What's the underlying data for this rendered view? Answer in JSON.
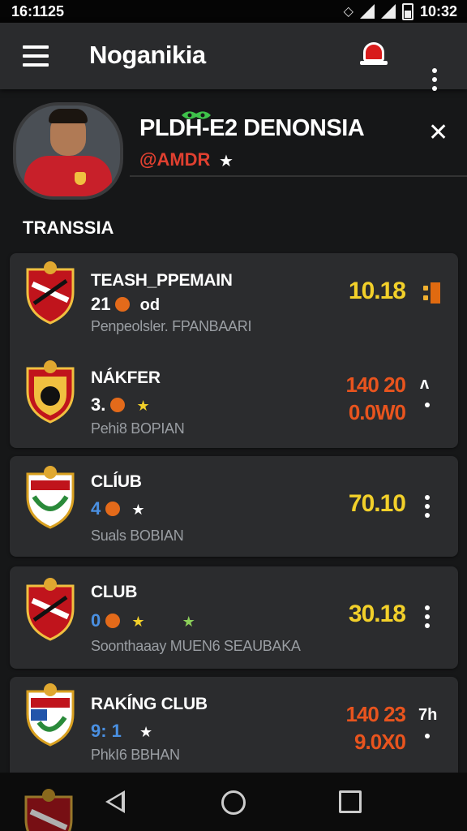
{
  "status_bar": {
    "time_left": "16:1125",
    "time_right": "10:32"
  },
  "app_bar": {
    "title": "Noganikia"
  },
  "profile": {
    "name": "PLDH-E2 DENONSIA",
    "handle": "@AMDR",
    "handle_star": "★",
    "subtitle": "TRANSSIA",
    "close_glyph": "✕"
  },
  "rows": [
    {
      "name": "TEASH_PPEMAIN",
      "stat": "21",
      "stat_suffix": "od",
      "desc": "Penpeolsler. FPANBAARI",
      "value": "10.18",
      "value_color": "#f2d02a",
      "icon": "bar-chart-icon"
    },
    {
      "name": "NÁKFER",
      "stat": "3.",
      "stat_star": "★",
      "desc": "Pehi8 BOPIAN",
      "value_line1": "140 20",
      "value_line2": "0.0W0",
      "value_color": "#e8541e",
      "side_glyph": "ʌ"
    },
    {
      "name": "CLÍUB",
      "stat": "4",
      "stat_star": "★",
      "desc": "Suals BOBIAN",
      "value": "70.10",
      "value_color": "#f2d02a"
    },
    {
      "name": "CLUB",
      "stat": "0",
      "stat_star": "★",
      "stat_star2": "★",
      "desc": "Soonthaaay MUEN6 SEAUBAKA",
      "value": "30.18",
      "value_color": "#f2d02a"
    },
    {
      "name": "RAKÍNG CLUB",
      "stat": "9: 1",
      "stat_star": "★",
      "desc": "PhkI6 BBHAN",
      "value_line1": "140 23",
      "value_line2": "9.0X0",
      "value_color": "#e8541e",
      "side_glyph": "7h"
    }
  ],
  "colors": {
    "yellow": "#f2d02a",
    "orange": "#e8541e",
    "blue": "#4a90e2",
    "red": "#e04030",
    "card_bg": "#2b2c2e"
  }
}
